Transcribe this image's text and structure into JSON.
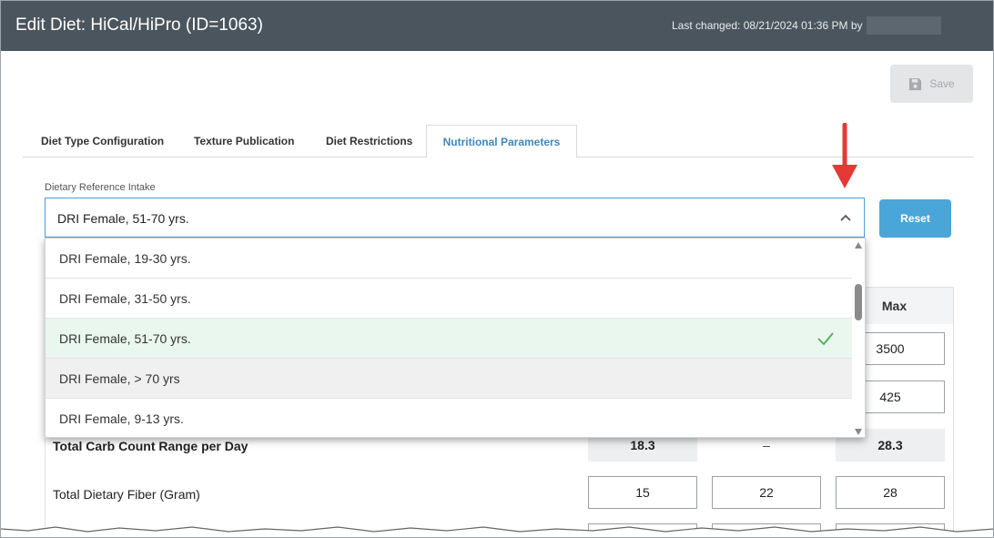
{
  "header": {
    "title": "Edit Diet: HiCal/HiPro (ID=1063)",
    "last_changed": "Last changed: 08/21/2024 01:36 PM by",
    "bg_color": "#4b555d"
  },
  "toolbar": {
    "save_label": "Save",
    "save_icon": "floppy-disk-icon"
  },
  "tabs": [
    {
      "label": "Diet Type Configuration",
      "active": false
    },
    {
      "label": "Texture Publication",
      "active": false
    },
    {
      "label": "Diet Restrictions",
      "active": false
    },
    {
      "label": "Nutritional Parameters",
      "active": true
    }
  ],
  "dri": {
    "label": "Dietary Reference Intake",
    "value": "DRI Female, 51-70 yrs.",
    "reset_label": "Reset",
    "options": [
      {
        "label": "DRI Female, 19-30 yrs.",
        "state": "normal"
      },
      {
        "label": "DRI Female, 31-50 yrs.",
        "state": "normal"
      },
      {
        "label": "DRI Female, 51-70 yrs.",
        "state": "selected"
      },
      {
        "label": "DRI Female, > 70 yrs",
        "state": "hover"
      },
      {
        "label": "DRI Female, 9-13 yrs.",
        "state": "normal"
      }
    ]
  },
  "table": {
    "max_header": "Max",
    "row1_max": "3500",
    "row2_max": "425",
    "carb_row": {
      "label": "Total Carb Count Range per Day",
      "min": "18.3",
      "sep": "–",
      "max": "28.3"
    },
    "fiber_row": {
      "label": "Total Dietary Fiber (Gram)",
      "min": "15",
      "target": "22",
      "max": "28"
    }
  },
  "colors": {
    "accent": "#3f86bd",
    "reset_button": "#4aa6d8",
    "selected_option": "#e9f7ef",
    "check": "#4caf50",
    "annotation_arrow": "#e53935"
  }
}
